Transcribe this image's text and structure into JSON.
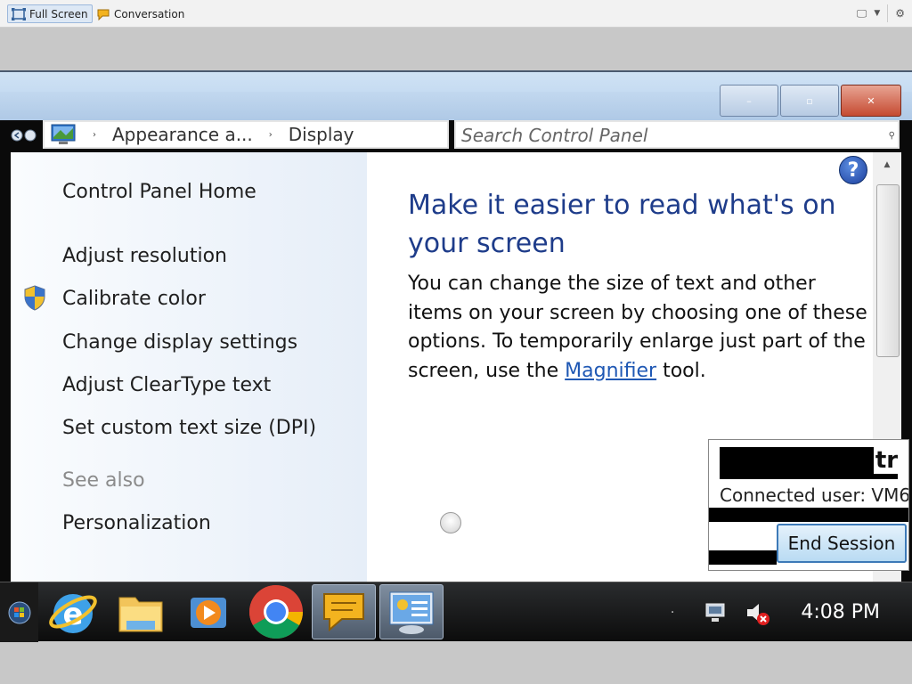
{
  "host_toolbar": {
    "full_screen_label": "Full Screen",
    "conversation_label": "Conversation"
  },
  "window": {
    "minimize_label": "–",
    "restore_label": "▫",
    "close_label": "✕"
  },
  "address": {
    "crumb1": "Appearance a...",
    "crumb2": "Display",
    "search_placeholder": "Search Control Panel"
  },
  "sidebar": {
    "items": [
      {
        "label": "Control Panel Home"
      },
      {
        "label": "Adjust resolution"
      },
      {
        "label": "Calibrate color"
      },
      {
        "label": "Change display settings"
      },
      {
        "label": "Adjust ClearType text"
      },
      {
        "label": "Set custom text size (DPI)"
      }
    ],
    "see_also": "See also",
    "personalization": "Personalization"
  },
  "main": {
    "heading": "Make it easier to read what's on your screen",
    "body_before_link": "You can change the size of text and other items on your screen by choosing one of these options. To temporarily enlarge just part of the screen, use the ",
    "link": "Magnifier",
    "body_after_link": " tool.",
    "help": "?"
  },
  "session": {
    "title": "tro",
    "user": "Connected user: VM6",
    "end_session_label": "End Session"
  },
  "taskbar": {
    "clock": "4:08 PM",
    "apps": [
      "internet-explorer",
      "file-explorer",
      "media-player",
      "chrome",
      "conversation",
      "control-panel"
    ]
  }
}
